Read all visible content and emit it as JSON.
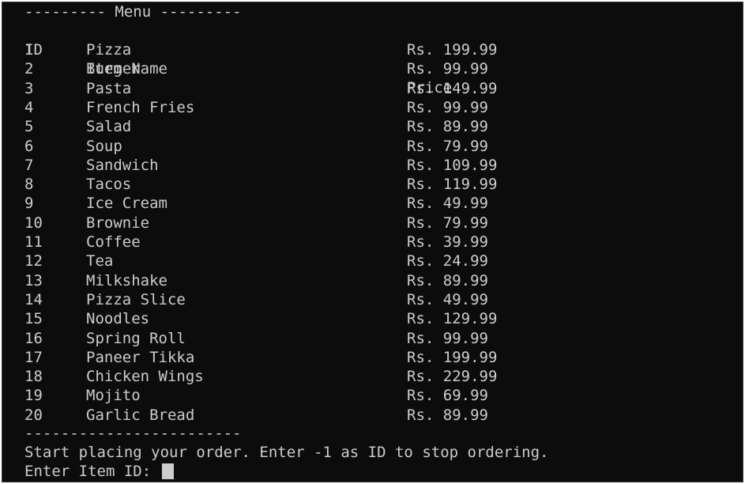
{
  "terminal": {
    "header": "--------- Menu ---------",
    "columns": {
      "id": "ID",
      "name": "Item Name",
      "price": "Price"
    },
    "items": [
      {
        "id": "1",
        "name": "Pizza",
        "price": "Rs. 199.99"
      },
      {
        "id": "2",
        "name": "Burger",
        "price": "Rs. 99.99"
      },
      {
        "id": "3",
        "name": "Pasta",
        "price": "Rs. 149.99"
      },
      {
        "id": "4",
        "name": "French Fries",
        "price": "Rs. 99.99"
      },
      {
        "id": "5",
        "name": "Salad",
        "price": "Rs. 89.99"
      },
      {
        "id": "6",
        "name": "Soup",
        "price": "Rs. 79.99"
      },
      {
        "id": "7",
        "name": "Sandwich",
        "price": "Rs. 109.99"
      },
      {
        "id": "8",
        "name": "Tacos",
        "price": "Rs. 119.99"
      },
      {
        "id": "9",
        "name": "Ice Cream",
        "price": "Rs. 49.99"
      },
      {
        "id": "10",
        "name": "Brownie",
        "price": "Rs. 79.99"
      },
      {
        "id": "11",
        "name": "Coffee",
        "price": "Rs. 39.99"
      },
      {
        "id": "12",
        "name": "Tea",
        "price": "Rs. 24.99"
      },
      {
        "id": "13",
        "name": "Milkshake",
        "price": "Rs. 89.99"
      },
      {
        "id": "14",
        "name": "Pizza Slice",
        "price": "Rs. 49.99"
      },
      {
        "id": "15",
        "name": "Noodles",
        "price": "Rs. 129.99"
      },
      {
        "id": "16",
        "name": "Spring Roll",
        "price": "Rs. 99.99"
      },
      {
        "id": "17",
        "name": "Paneer Tikka",
        "price": "Rs. 199.99"
      },
      {
        "id": "18",
        "name": "Chicken Wings",
        "price": "Rs. 229.99"
      },
      {
        "id": "19",
        "name": "Mojito",
        "price": "Rs. 69.99"
      },
      {
        "id": "20",
        "name": "Garlic Bread",
        "price": "Rs. 89.99"
      }
    ],
    "footer_divider": "------------------------",
    "instruction": "Start placing your order. Enter -1 as ID to stop ordering.",
    "prompt": "Enter Item ID: "
  },
  "colors": {
    "background": "#0c0c0c",
    "foreground": "#cccccc"
  }
}
